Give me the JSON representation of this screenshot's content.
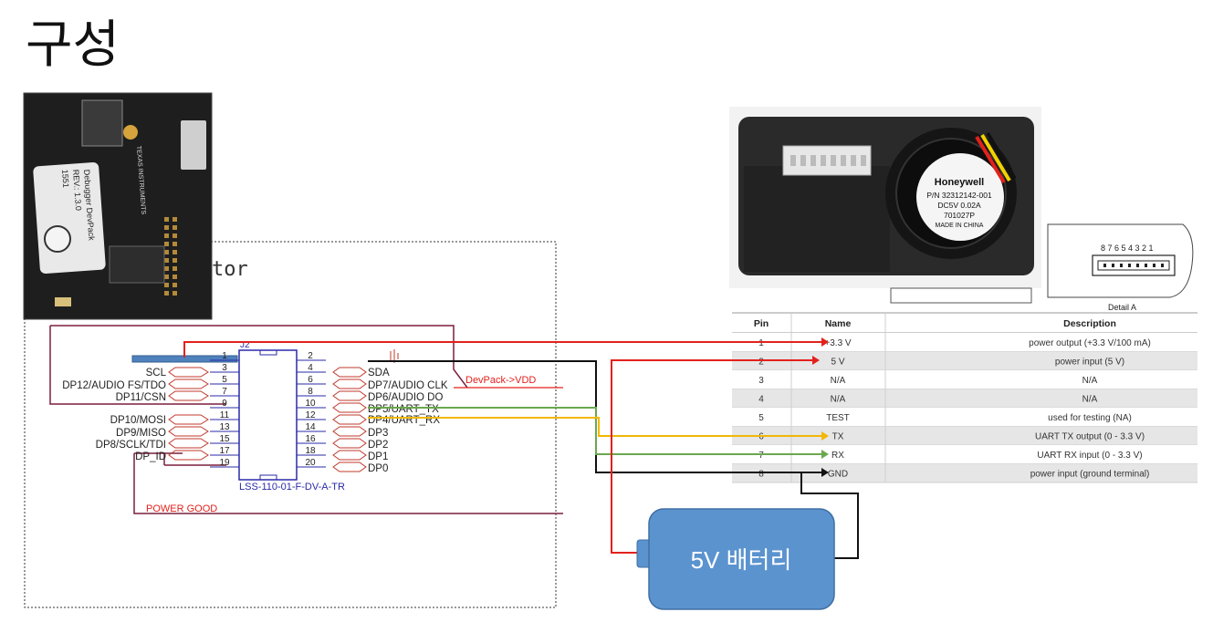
{
  "page_title": "구성",
  "schematic": {
    "partial_title": "tor",
    "connector_ref": "J2",
    "connector_part": "LSS-110-01-F-DV-A-TR",
    "left_labels": [
      "SCL",
      "DP12/AUDIO FS/TDO",
      "DP11/CSN",
      "DP10/MOSI",
      "DP9/MISO",
      "DP8/SCLK/TDI",
      "DP_ID"
    ],
    "right_labels": [
      "SDA",
      "DP7/AUDIO CLK",
      "DP6/AUDIO DO",
      "DP5/UART_TX",
      "DP4/UART_RX",
      "DP3",
      "DP2",
      "DP1",
      "DP0"
    ],
    "odd_pins": [
      "1",
      "3",
      "5",
      "7",
      "9",
      "11",
      "13",
      "15",
      "17",
      "19"
    ],
    "even_pins": [
      "2",
      "4",
      "6",
      "8",
      "10",
      "12",
      "14",
      "16",
      "18",
      "20"
    ],
    "net_devpack_vdd": "DevPack->VDD",
    "net_power_good": "POWER GOOD"
  },
  "devpack_photo": {
    "board_text": [
      "Debugger DevPack",
      "REV.: 1.3.0",
      "1551"
    ],
    "brand_text": "TEXAS INSTRUMENTS"
  },
  "sensor_photo": {
    "label_lines": [
      "Honeywell",
      "P/N 32312142-001",
      "DC5V 0.02A",
      "701027P",
      "MADE IN CHINA"
    ]
  },
  "detail_view": {
    "pin_numbers": "8 7 6 5 4 3 2 1",
    "caption": "Detail A"
  },
  "pin_table": {
    "headers": [
      "Pin",
      "Name",
      "Description"
    ],
    "rows": [
      [
        "1",
        "+3.3 V",
        "power output (+3.3 V/100 mA)"
      ],
      [
        "2",
        "5 V",
        "power input (5 V)"
      ],
      [
        "3",
        "N/A",
        "N/A"
      ],
      [
        "4",
        "N/A",
        "N/A"
      ],
      [
        "5",
        "TEST",
        "used for testing (NA)"
      ],
      [
        "6",
        "TX",
        "UART TX output (0 - 3.3 V)"
      ],
      [
        "7",
        "RX",
        "UART RX input (0 - 3.3 V)"
      ],
      [
        "8",
        "GND",
        "power input (ground terminal)"
      ]
    ]
  },
  "battery": {
    "label": "5V 배터리",
    "color": "#5b93cf"
  },
  "wire_colors": {
    "red": "#e3211c",
    "black": "#111111",
    "yellow": "#f2b705",
    "green": "#6aa84f",
    "maroon": "#7b1f3d"
  }
}
